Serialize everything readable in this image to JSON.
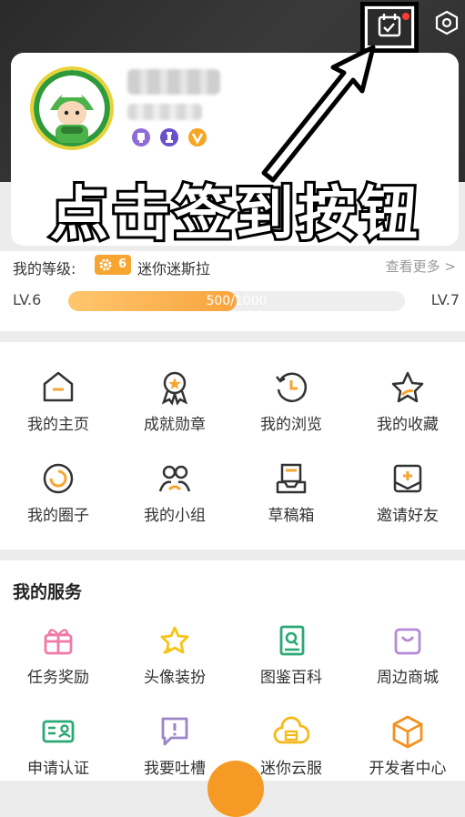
{
  "header": {
    "calendar_icon": "calendar-check-icon",
    "settings_icon": "hexagon-gear-icon",
    "calendar_has_notification": true
  },
  "profile": {
    "avatar_icon": "green-hat-character-avatar",
    "badges": [
      "purple-trophy-badge",
      "purple-chess-badge",
      "orange-v-badge"
    ],
    "badge_colors": [
      "#8e6bd6",
      "#6b51c9",
      "#f5a623"
    ]
  },
  "annotation": {
    "overlay_text": "点击签到按钮"
  },
  "level": {
    "label": "我的等级:",
    "chip_number": "6",
    "name": "迷你迷斯拉",
    "see_more": "查看更多 >",
    "current_level": "LV.6",
    "next_level": "LV.7",
    "progress_text": "500/1000",
    "progress_fraction": 0.5
  },
  "menu": [
    {
      "label": "我的主页",
      "icon": "home-icon"
    },
    {
      "label": "成就勋章",
      "icon": "medal-icon"
    },
    {
      "label": "我的浏览",
      "icon": "history-clock-icon"
    },
    {
      "label": "我的收藏",
      "icon": "star-icon"
    },
    {
      "label": "我的圈子",
      "icon": "circle-icon"
    },
    {
      "label": "我的小组",
      "icon": "group-icon"
    },
    {
      "label": "草稿箱",
      "icon": "drafts-tray-icon"
    },
    {
      "label": "邀请好友",
      "icon": "invite-card-icon"
    }
  ],
  "services": {
    "title": "我的服务",
    "items": [
      {
        "label": "任务奖励",
        "icon": "gift-icon"
      },
      {
        "label": "头像装扮",
        "icon": "sparkle-star-icon"
      },
      {
        "label": "图鉴百科",
        "icon": "encyclopedia-book-icon"
      },
      {
        "label": "周边商城",
        "icon": "shopping-bag-icon"
      },
      {
        "label": "申请认证",
        "icon": "id-card-icon"
      },
      {
        "label": "我要吐槽",
        "icon": "feedback-bubble-icon"
      },
      {
        "label": "迷你云服",
        "icon": "cloud-server-icon"
      },
      {
        "label": "开发者中心",
        "icon": "developer-cube-icon"
      }
    ]
  },
  "colors": {
    "accent": "#f9a43d",
    "header_bg": "#333333"
  }
}
